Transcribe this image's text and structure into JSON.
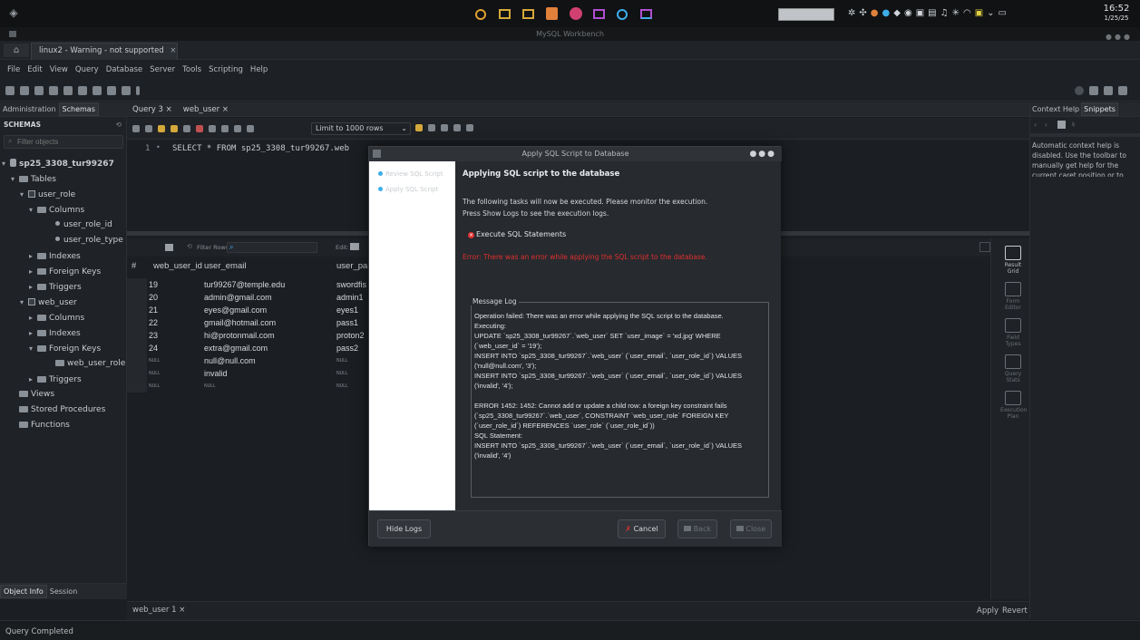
{
  "os": {
    "clock_time": "16:52",
    "clock_date": "1/25/25"
  },
  "window_title": "MySQL Workbench",
  "connection_tab": "linux2 - Warning - not supported",
  "menu": [
    "File",
    "Edit",
    "View",
    "Query",
    "Database",
    "Server",
    "Tools",
    "Scripting",
    "Help"
  ],
  "left_panel": {
    "tabs": [
      "Administration",
      "Schemas"
    ],
    "header": "SCHEMAS",
    "filter_placeholder": "Filter objects",
    "tree": [
      {
        "label": "sp25_3308_tur99267",
        "indent": 0,
        "icon": "db",
        "arrow": "▾"
      },
      {
        "label": "Tables",
        "indent": 1,
        "icon": "folder",
        "arrow": "▾"
      },
      {
        "label": "user_role",
        "indent": 2,
        "icon": "table",
        "arrow": "▾"
      },
      {
        "label": "Columns",
        "indent": 3,
        "icon": "folder",
        "arrow": "▾"
      },
      {
        "label": "user_role_id",
        "indent": 5,
        "icon": "dot",
        "arrow": ""
      },
      {
        "label": "user_role_type",
        "indent": 5,
        "icon": "dot",
        "arrow": ""
      },
      {
        "label": "Indexes",
        "indent": 3,
        "icon": "folder",
        "arrow": "▸"
      },
      {
        "label": "Foreign Keys",
        "indent": 3,
        "icon": "folder",
        "arrow": "▸"
      },
      {
        "label": "Triggers",
        "indent": 3,
        "icon": "folder",
        "arrow": "▸"
      },
      {
        "label": "web_user",
        "indent": 2,
        "icon": "table",
        "arrow": "▾"
      },
      {
        "label": "Columns",
        "indent": 3,
        "icon": "folder",
        "arrow": "▸"
      },
      {
        "label": "Indexes",
        "indent": 3,
        "icon": "folder",
        "arrow": "▸"
      },
      {
        "label": "Foreign Keys",
        "indent": 3,
        "icon": "folder",
        "arrow": "▾"
      },
      {
        "label": "web_user_role",
        "indent": 5,
        "icon": "folder",
        "arrow": ""
      },
      {
        "label": "Triggers",
        "indent": 3,
        "icon": "folder",
        "arrow": "▸"
      },
      {
        "label": "Views",
        "indent": 1,
        "icon": "folder",
        "arrow": ""
      },
      {
        "label": "Stored Procedures",
        "indent": 1,
        "icon": "folder",
        "arrow": ""
      },
      {
        "label": "Functions",
        "indent": 1,
        "icon": "folder",
        "arrow": ""
      }
    ],
    "bottom_tabs": [
      "Object Info",
      "Session"
    ]
  },
  "editor": {
    "tabs": [
      "Query 3",
      "web_user"
    ],
    "limit_label": "Limit to 1000 rows",
    "line_number": "1",
    "sql_visible": "SELECT * FROM sp25_3308_tur99267.web"
  },
  "grid": {
    "filter_label": "Filter Rows:",
    "edit_label": "Edit:",
    "columns": [
      "#",
      "web_user_id",
      "user_email",
      "user_pa"
    ],
    "rows": [
      {
        "id": "19",
        "email": "tur99267@temple.edu",
        "pass": "swordfis"
      },
      {
        "id": "20",
        "email": "admin@gmail.com",
        "pass": "admin1"
      },
      {
        "id": "21",
        "email": "eyes@gmail.com",
        "pass": "eyes1"
      },
      {
        "id": "22",
        "email": "gmail@hotmail.com",
        "pass": "pass1"
      },
      {
        "id": "23",
        "email": "hi@protonmail.com",
        "pass": "proton2"
      },
      {
        "id": "24",
        "email": "extra@gmail.com",
        "pass": "pass2"
      },
      {
        "id": "NULL",
        "email": "null@null.com",
        "pass": "NULL"
      },
      {
        "id": "NULL",
        "email": "invalid",
        "pass": "NULL"
      },
      {
        "id": "NULL",
        "email": "NULL",
        "pass": "NULL"
      }
    ]
  },
  "right_side_buttons": [
    {
      "label": "Result Grid",
      "icon": "result-grid-icon"
    },
    {
      "label": "Form Editor",
      "icon": "form-editor-icon"
    },
    {
      "label": "Field Types",
      "icon": "field-types-icon"
    },
    {
      "label": "Query Stats",
      "icon": "query-stats-icon"
    },
    {
      "label": "Execution Plan",
      "icon": "execution-plan-icon"
    }
  ],
  "right_panel": {
    "tabs": [
      "Context Help",
      "Snippets"
    ],
    "help_text": "Automatic context help is disabled. Use the toolbar to manually get help for the current caret position or to toggle automatic help."
  },
  "result_tab": "web_user 1",
  "apply_label": "Apply",
  "revert_label": "Revert",
  "status": "Query Completed",
  "dialog": {
    "title": "Apply SQL Script to Database",
    "steps": [
      "Review SQL Script",
      "Apply SQL Script"
    ],
    "heading": "Applying SQL script to the database",
    "intro_line1": "The following tasks will now be executed. Please monitor the execution.",
    "intro_line2": "Press Show Logs to see the execution logs.",
    "task": "Execute SQL Statements",
    "error_line": "Error: There was an error while applying the SQL script to the database.",
    "log_title": "Message Log",
    "log_text": "Operation failed: There was an error while applying the SQL script to the database.\nExecuting:\nUPDATE `sp25_3308_tur99267`.`web_user` SET `user_image` = 'xd.jpg' WHERE (`web_user_id` = '19');\nINSERT INTO `sp25_3308_tur99267`.`web_user` (`user_email`, `user_role_id`) VALUES ('null@null.com', '3');\nINSERT INTO `sp25_3308_tur99267`.`web_user` (`user_email`, `user_role_id`) VALUES ('invalid', '4');\n\nERROR 1452: 1452: Cannot add or update a child row: a foreign key constraint fails (`sp25_3308_tur99267`.`web_user`, CONSTRAINT `web_user_role` FOREIGN KEY (`user_role_id`) REFERENCES `user_role` (`user_role_id`))\nSQL Statement:\nINSERT INTO `sp25_3308_tur99267`.`web_user` (`user_email`, `user_role_id`) VALUES ('invalid', '4')",
    "hide_logs": "Hide Logs",
    "cancel": "Cancel",
    "back": "Back",
    "close": "Close"
  },
  "colors": {
    "error": "#e03030",
    "accent": "#3daee9"
  }
}
